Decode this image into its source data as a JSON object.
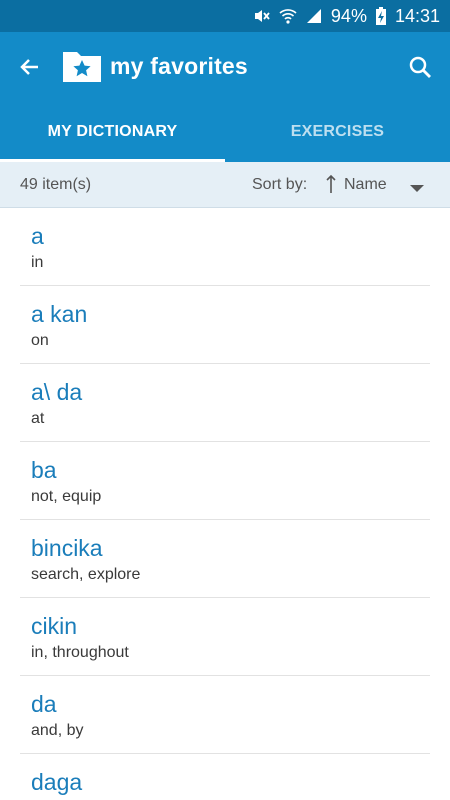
{
  "status_bar": {
    "battery": "94%",
    "time": "14:31"
  },
  "header": {
    "title": "my favorites"
  },
  "tabs": [
    {
      "label": "MY DICTIONARY",
      "active": true
    },
    {
      "label": "EXERCISES",
      "active": false
    }
  ],
  "sort_bar": {
    "count": "49 item(s)",
    "sort_label": "Sort by:",
    "sort_value": "Name"
  },
  "entries": [
    {
      "term": "a",
      "translation": "in"
    },
    {
      "term": "a kan",
      "translation": "on"
    },
    {
      "term": "a\\ da",
      "translation": "at"
    },
    {
      "term": "ba",
      "translation": "not, equip"
    },
    {
      "term": "bincika",
      "translation": "search, explore"
    },
    {
      "term": "cikin",
      "translation": "in, throughout"
    },
    {
      "term": "da",
      "translation": "and, by"
    },
    {
      "term": "daga",
      "translation": ""
    }
  ],
  "colors": {
    "app_bar": "#138bc8",
    "status_bar": "#0b6ea1",
    "term_text": "#1a7dba",
    "sort_bar": "#e5eff6"
  }
}
